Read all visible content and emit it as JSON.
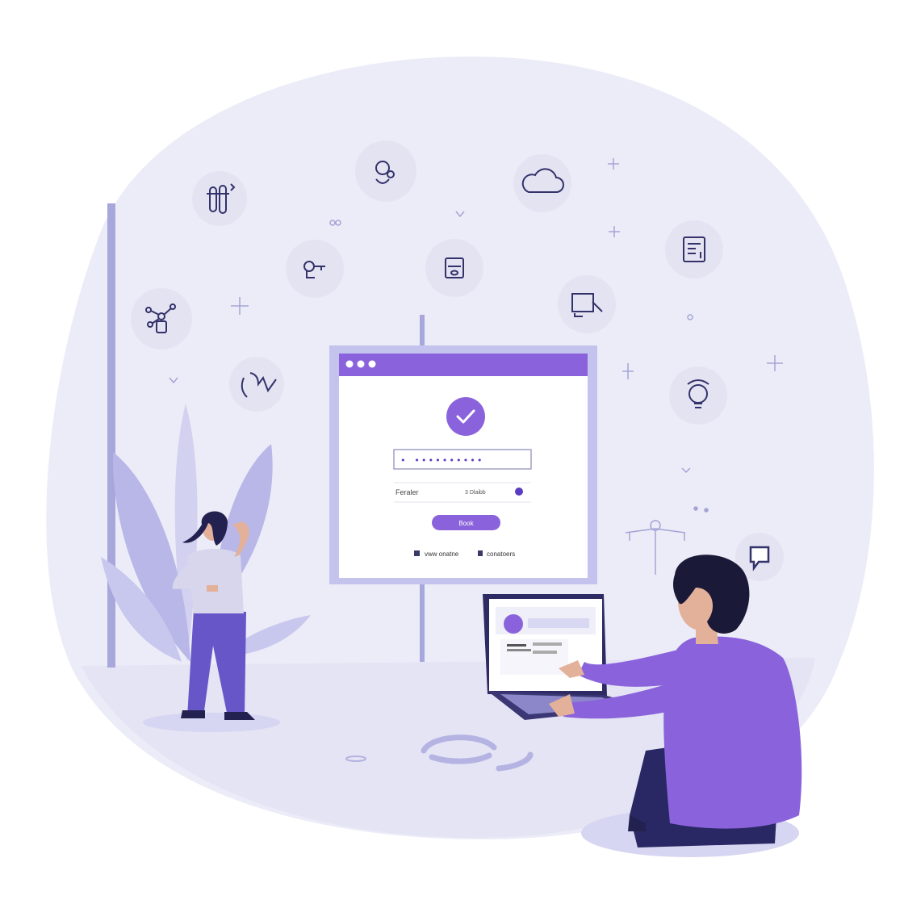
{
  "palette": {
    "background": "#ffffff",
    "blob": "#ececf8",
    "floor": "#e4e4f5",
    "purple": "#8a63dc",
    "purple_dark": "#7b5ad6",
    "navy": "#23214f",
    "line": "#a3a3d6",
    "leaf": "#b8b7e8",
    "circle": "#e3e3f2"
  },
  "monitor": {
    "window_dots": 3,
    "status": "check-icon",
    "password_value": "• ••••••••••",
    "remember_label": "Feraler",
    "remember_value": "3 Dlaibb",
    "button_label": "Book",
    "footer_link_1": "vww onatne",
    "footer_link_2": "conatoers"
  },
  "laptop": {
    "screen_tab": "user profile tab",
    "avatar": "cloud-avatar-icon"
  },
  "floating_icons": [
    "test-tubes-icon",
    "gear-person-icon",
    "cloud-icon",
    "key-icon",
    "calculator-icon",
    "document-icon",
    "network-icon",
    "card-edit-icon",
    "face-profile-icon",
    "lightbulb-icon",
    "chat-bubble-icon"
  ]
}
